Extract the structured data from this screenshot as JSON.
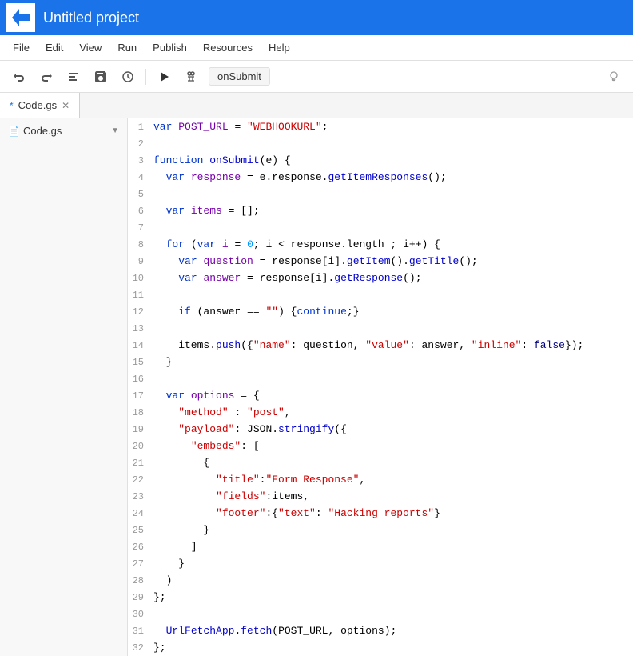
{
  "topbar": {
    "title": "Untitled project"
  },
  "menu": {
    "items": [
      "File",
      "Edit",
      "View",
      "Run",
      "Publish",
      "Resources",
      "Help"
    ]
  },
  "toolbar": {
    "function_name": "onSubmit"
  },
  "sidebar": {
    "file_name": "Code.gs"
  },
  "tabs": {
    "items": [
      {
        "label": "Code.gs",
        "modified": true,
        "active": true
      }
    ]
  },
  "code": {
    "lines": [
      {
        "num": 1,
        "text": "var POST_URL = \"WEBHOOKURL\";"
      },
      {
        "num": 2,
        "text": ""
      },
      {
        "num": 3,
        "text": "function onSubmit(e) {"
      },
      {
        "num": 4,
        "text": "  var response = e.response.getItemResponses();"
      },
      {
        "num": 5,
        "text": ""
      },
      {
        "num": 6,
        "text": "  var items = [];"
      },
      {
        "num": 7,
        "text": ""
      },
      {
        "num": 8,
        "text": "  for (var i = 0; i < response.length ; i++) {"
      },
      {
        "num": 9,
        "text": "    var question = response[i].getItem().getTitle();"
      },
      {
        "num": 10,
        "text": "    var answer = response[i].getResponse();"
      },
      {
        "num": 11,
        "text": ""
      },
      {
        "num": 12,
        "text": "    if (answer == \"\") {continue;}"
      },
      {
        "num": 13,
        "text": ""
      },
      {
        "num": 14,
        "text": "    items.push({\"name\": question, \"value\": answer, \"inline\": false});"
      },
      {
        "num": 15,
        "text": "  }"
      },
      {
        "num": 16,
        "text": ""
      },
      {
        "num": 17,
        "text": "  var options = {"
      },
      {
        "num": 18,
        "text": "    \"method\" : \"post\","
      },
      {
        "num": 19,
        "text": "    \"payload\": JSON.stringify({"
      },
      {
        "num": 20,
        "text": "      \"embeds\": ["
      },
      {
        "num": 21,
        "text": "        {"
      },
      {
        "num": 22,
        "text": "          \"title\":\"Form Response\","
      },
      {
        "num": 23,
        "text": "          \"fields\":items,"
      },
      {
        "num": 24,
        "text": "          \"footer\":{\"text\": \"Hacking reports\"}"
      },
      {
        "num": 25,
        "text": "        }"
      },
      {
        "num": 26,
        "text": "      ]"
      },
      {
        "num": 27,
        "text": "    }"
      },
      {
        "num": 28,
        "text": "  )"
      },
      {
        "num": 29,
        "text": "};"
      },
      {
        "num": 30,
        "text": ""
      },
      {
        "num": 31,
        "text": "  UrlFetchApp.fetch(POST_URL, options);"
      },
      {
        "num": 32,
        "text": "};"
      }
    ]
  }
}
